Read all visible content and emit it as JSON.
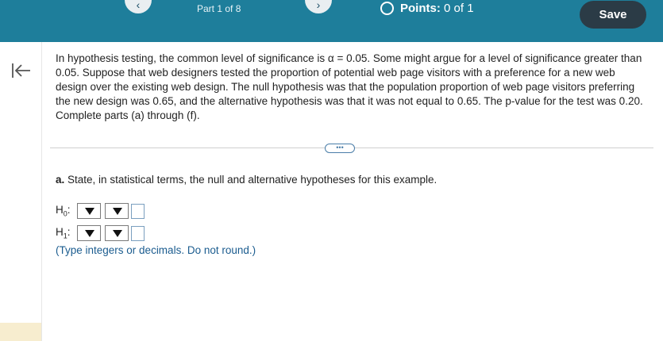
{
  "header": {
    "part_label": "Part 1 of 8",
    "points_label": "Points:",
    "points_value": "0 of 1",
    "save_label": "Save",
    "prev_icon": "chevron-left-icon",
    "next_icon": "chevron-right-icon",
    "background_color": "#1e7e9b"
  },
  "question": {
    "text": "In hypothesis testing, the common level of significance is α = 0.05. Some might argue for a level of significance greater than 0.05. Suppose that web designers tested the proportion of potential web page visitors with a preference for a new web design over the existing web design. The null hypothesis was that the population proportion of web page visitors preferring the new design was 0.65, and the alternative hypothesis was that it was not equal to 0.65. The p-value for the test was 0.20. Complete parts (a) through (f).",
    "more_label": "•••"
  },
  "part_a": {
    "letter": "a.",
    "prompt": "State, in statistical terms, the null and alternative hypotheses for this example.",
    "h0_label": "H",
    "h0_sub": "0",
    "h1_label": "H",
    "h1_sub": "1",
    "hint": "(Type integers or decimals. Do not round.)"
  }
}
